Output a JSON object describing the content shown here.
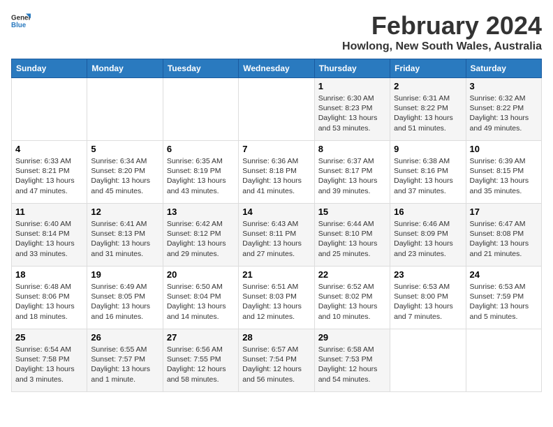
{
  "logo": {
    "line1": "General",
    "line2": "Blue"
  },
  "title": "February 2024",
  "location": "Howlong, New South Wales, Australia",
  "days_of_week": [
    "Sunday",
    "Monday",
    "Tuesday",
    "Wednesday",
    "Thursday",
    "Friday",
    "Saturday"
  ],
  "weeks": [
    [
      {
        "day": "",
        "info": ""
      },
      {
        "day": "",
        "info": ""
      },
      {
        "day": "",
        "info": ""
      },
      {
        "day": "",
        "info": ""
      },
      {
        "day": "1",
        "info": "Sunrise: 6:30 AM\nSunset: 8:23 PM\nDaylight: 13 hours\nand 53 minutes."
      },
      {
        "day": "2",
        "info": "Sunrise: 6:31 AM\nSunset: 8:22 PM\nDaylight: 13 hours\nand 51 minutes."
      },
      {
        "day": "3",
        "info": "Sunrise: 6:32 AM\nSunset: 8:22 PM\nDaylight: 13 hours\nand 49 minutes."
      }
    ],
    [
      {
        "day": "4",
        "info": "Sunrise: 6:33 AM\nSunset: 8:21 PM\nDaylight: 13 hours\nand 47 minutes."
      },
      {
        "day": "5",
        "info": "Sunrise: 6:34 AM\nSunset: 8:20 PM\nDaylight: 13 hours\nand 45 minutes."
      },
      {
        "day": "6",
        "info": "Sunrise: 6:35 AM\nSunset: 8:19 PM\nDaylight: 13 hours\nand 43 minutes."
      },
      {
        "day": "7",
        "info": "Sunrise: 6:36 AM\nSunset: 8:18 PM\nDaylight: 13 hours\nand 41 minutes."
      },
      {
        "day": "8",
        "info": "Sunrise: 6:37 AM\nSunset: 8:17 PM\nDaylight: 13 hours\nand 39 minutes."
      },
      {
        "day": "9",
        "info": "Sunrise: 6:38 AM\nSunset: 8:16 PM\nDaylight: 13 hours\nand 37 minutes."
      },
      {
        "day": "10",
        "info": "Sunrise: 6:39 AM\nSunset: 8:15 PM\nDaylight: 13 hours\nand 35 minutes."
      }
    ],
    [
      {
        "day": "11",
        "info": "Sunrise: 6:40 AM\nSunset: 8:14 PM\nDaylight: 13 hours\nand 33 minutes."
      },
      {
        "day": "12",
        "info": "Sunrise: 6:41 AM\nSunset: 8:13 PM\nDaylight: 13 hours\nand 31 minutes."
      },
      {
        "day": "13",
        "info": "Sunrise: 6:42 AM\nSunset: 8:12 PM\nDaylight: 13 hours\nand 29 minutes."
      },
      {
        "day": "14",
        "info": "Sunrise: 6:43 AM\nSunset: 8:11 PM\nDaylight: 13 hours\nand 27 minutes."
      },
      {
        "day": "15",
        "info": "Sunrise: 6:44 AM\nSunset: 8:10 PM\nDaylight: 13 hours\nand 25 minutes."
      },
      {
        "day": "16",
        "info": "Sunrise: 6:46 AM\nSunset: 8:09 PM\nDaylight: 13 hours\nand 23 minutes."
      },
      {
        "day": "17",
        "info": "Sunrise: 6:47 AM\nSunset: 8:08 PM\nDaylight: 13 hours\nand 21 minutes."
      }
    ],
    [
      {
        "day": "18",
        "info": "Sunrise: 6:48 AM\nSunset: 8:06 PM\nDaylight: 13 hours\nand 18 minutes."
      },
      {
        "day": "19",
        "info": "Sunrise: 6:49 AM\nSunset: 8:05 PM\nDaylight: 13 hours\nand 16 minutes."
      },
      {
        "day": "20",
        "info": "Sunrise: 6:50 AM\nSunset: 8:04 PM\nDaylight: 13 hours\nand 14 minutes."
      },
      {
        "day": "21",
        "info": "Sunrise: 6:51 AM\nSunset: 8:03 PM\nDaylight: 13 hours\nand 12 minutes."
      },
      {
        "day": "22",
        "info": "Sunrise: 6:52 AM\nSunset: 8:02 PM\nDaylight: 13 hours\nand 10 minutes."
      },
      {
        "day": "23",
        "info": "Sunrise: 6:53 AM\nSunset: 8:00 PM\nDaylight: 13 hours\nand 7 minutes."
      },
      {
        "day": "24",
        "info": "Sunrise: 6:53 AM\nSunset: 7:59 PM\nDaylight: 13 hours\nand 5 minutes."
      }
    ],
    [
      {
        "day": "25",
        "info": "Sunrise: 6:54 AM\nSunset: 7:58 PM\nDaylight: 13 hours\nand 3 minutes."
      },
      {
        "day": "26",
        "info": "Sunrise: 6:55 AM\nSunset: 7:57 PM\nDaylight: 13 hours\nand 1 minute."
      },
      {
        "day": "27",
        "info": "Sunrise: 6:56 AM\nSunset: 7:55 PM\nDaylight: 12 hours\nand 58 minutes."
      },
      {
        "day": "28",
        "info": "Sunrise: 6:57 AM\nSunset: 7:54 PM\nDaylight: 12 hours\nand 56 minutes."
      },
      {
        "day": "29",
        "info": "Sunrise: 6:58 AM\nSunset: 7:53 PM\nDaylight: 12 hours\nand 54 minutes."
      },
      {
        "day": "",
        "info": ""
      },
      {
        "day": "",
        "info": ""
      }
    ]
  ]
}
